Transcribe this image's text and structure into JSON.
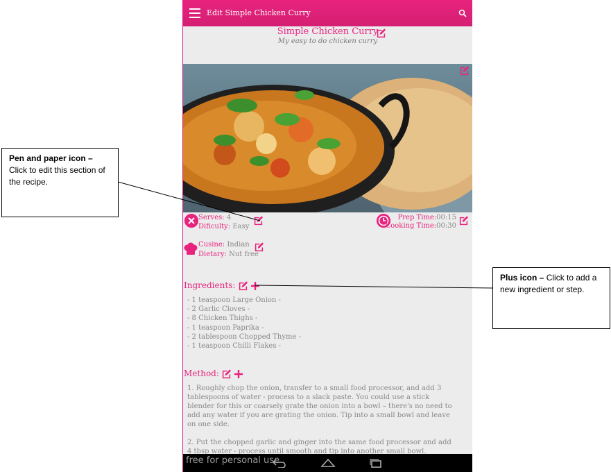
{
  "appbar": {
    "title": "Edit Simple Chicken Curry"
  },
  "recipe": {
    "title": "Simple Chicken Curry",
    "subtitle": "My easy to do chicken curry"
  },
  "meta": {
    "serves_label": "Serves:",
    "serves_value": "4",
    "difficulty_label": "Dificulty:",
    "difficulty_value": "Easy",
    "prep_label": "Prep Time:",
    "prep_value": "00:15",
    "cooking_label": "Cooking Time:",
    "cooking_value": "00:30",
    "cuisine_label": "Cusine:",
    "cuisine_value": "Indian",
    "dietary_label": "Dietary:",
    "dietary_value": "Nut free"
  },
  "ingredients": {
    "heading": "Ingredients:",
    "items": [
      "- 1 teaspoon Large Onion -",
      "- 2   Garlic Cloves -",
      "- 8   Chicken Thighs -",
      "- 1 teaspoon Paprika -",
      "- 2 tablespoon Chopped Thyme -",
      "- 1 teaspoon Chilli Flakes -"
    ]
  },
  "method": {
    "heading": "Method:",
    "steps": [
      "1. Roughly chop the onion, transfer to a small food processor, and add 3 tablespoons of water - process to a slack paste. You could use a stick blender for this or coarsely grate the onion into a bowl – there's no need to add any water if you are grating the onion. Tip into a small bowl and leave on one side.",
      "2. Put the chopped garlic and ginger into the same food processor and add 4 tbsp water - process until smooth and tip into another small bowl."
    ]
  },
  "watermark": "free for personal use",
  "callouts": {
    "pen": {
      "title": "Pen and paper icon –",
      "text": " Click to edit this section of the recipe."
    },
    "plus": {
      "title": "Plus icon –",
      "text": " Click to add a new ingredient or step."
    }
  },
  "colors": {
    "accent": "#e8237e",
    "background": "#ececec",
    "text": "#888888"
  }
}
